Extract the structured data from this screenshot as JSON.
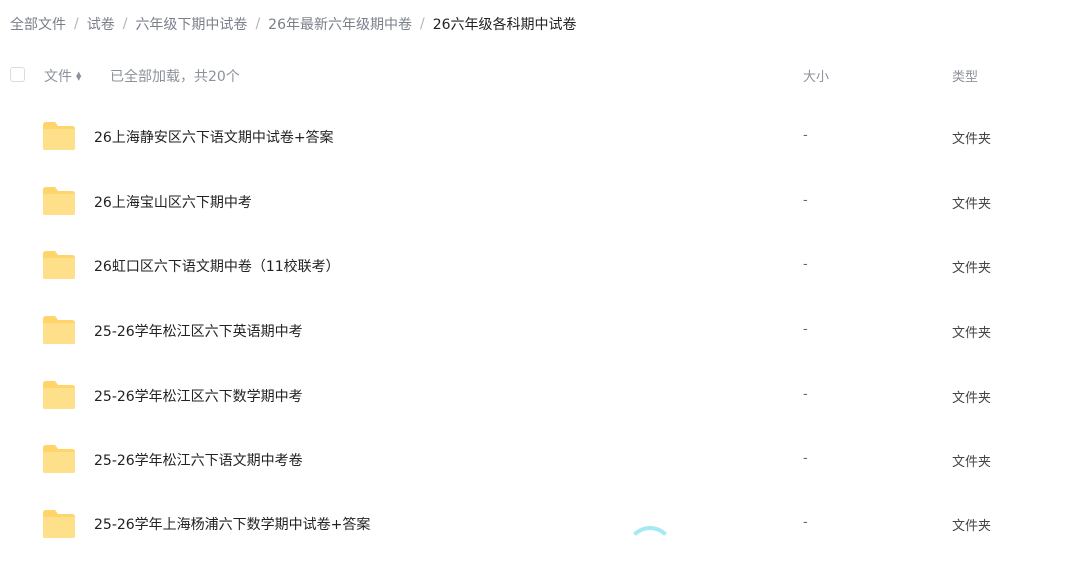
{
  "breadcrumb": [
    "全部文件",
    "试卷",
    "六年级下期中试卷",
    "26年最新六年级期中卷",
    "26六年级各科期中试卷"
  ],
  "header": {
    "name_label": "文件",
    "load_status": "已全部加载，共20个",
    "size_label": "大小",
    "type_label": "类型"
  },
  "files": [
    {
      "name": "26上海静安区六下语文期中试卷+答案",
      "size": "-",
      "type": "文件夹"
    },
    {
      "name": "26上海宝山区六下期中考",
      "size": "-",
      "type": "文件夹"
    },
    {
      "name": "26虹口区六下语文期中卷（11校联考）",
      "size": "-",
      "type": "文件夹"
    },
    {
      "name": "25-26学年松江区六下英语期中考",
      "size": "-",
      "type": "文件夹"
    },
    {
      "name": "25-26学年松江区六下数学期中考",
      "size": "-",
      "type": "文件夹"
    },
    {
      "name": "25-26学年松江六下语文期中考卷",
      "size": "-",
      "type": "文件夹"
    },
    {
      "name": "25-26学年上海杨浦六下数学期中试卷+答案",
      "size": "-",
      "type": "文件夹"
    }
  ],
  "icons": {
    "folder": "folder-icon",
    "sort": "sort-icon"
  },
  "colors": {
    "folder_top": "#ffd56b",
    "folder_body": "#ffe08a"
  }
}
